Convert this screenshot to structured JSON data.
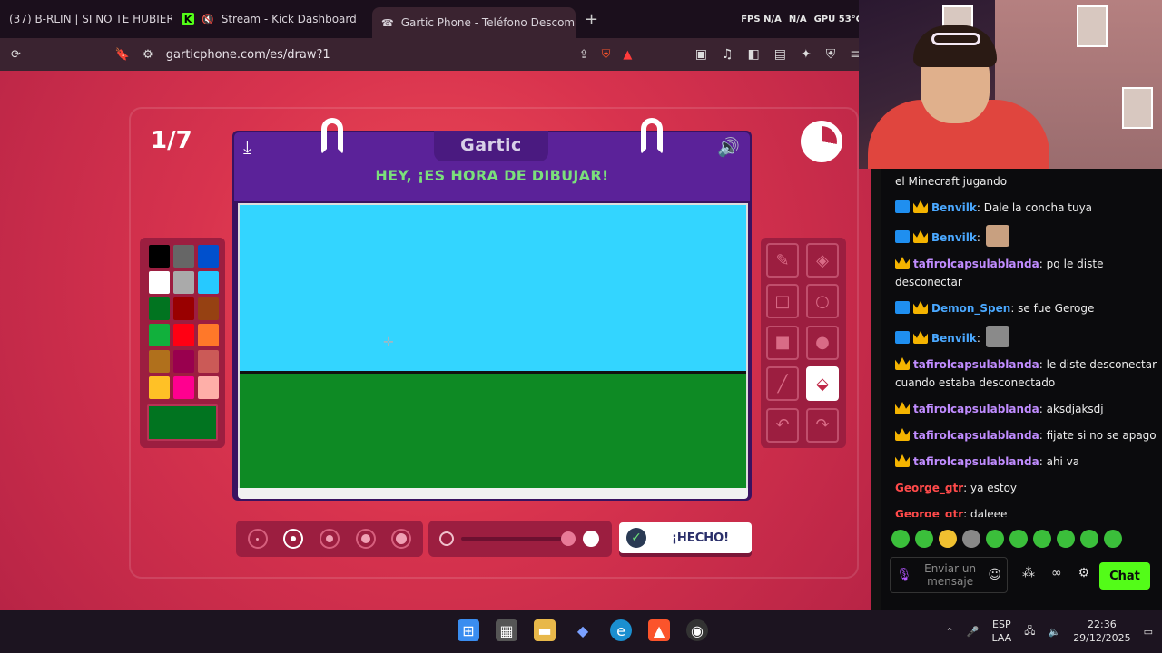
{
  "browser": {
    "tabs": [
      {
        "label": "(37) B-RLIN | SI NO TE HUBIERAS"
      },
      {
        "label": "Stream - Kick Dashboard"
      },
      {
        "label": "Gartic Phone - Teléfono Descom"
      }
    ],
    "new_tab": "+",
    "sysinfo": [
      "FPS N/A",
      "N/A",
      "GPU 53°C"
    ],
    "url": "garticphone.com/es/draw?1"
  },
  "game": {
    "round": "1/7",
    "logo": "Gartic",
    "prompt": "HEY, ¡ES HORA DE DIBUJAR!",
    "done_label": "¡HECHO!",
    "timer_fraction_elapsed": 0.28,
    "palette": [
      "#000000",
      "#666666",
      "#0050cd",
      "#ffffff",
      "#aaaaaa",
      "#26c9ff",
      "#017420",
      "#990000",
      "#964112",
      "#11b03c",
      "#ff0013",
      "#ff7829",
      "#b0701c",
      "#99004e",
      "#cb5a57",
      "#ffc126",
      "#ff008f",
      "#feafa8"
    ],
    "current_color": "#017420",
    "sky_color": "#33d5ff",
    "ground_color": "#0e8a24",
    "tools": [
      "pencil-icon",
      "eraser-icon",
      "rectangle-icon",
      "ellipse-icon",
      "filled-rectangle-icon",
      "filled-ellipse-icon",
      "line-icon",
      "fill-bucket-icon",
      "undo-icon",
      "redo-icon"
    ],
    "selected_tool": "fill-bucket-icon",
    "brush_size_selected_index": 1
  },
  "chat": {
    "messages": [
      {
        "user": "",
        "color": "#ececec",
        "text": "el Minecraft jugando",
        "badges": []
      },
      {
        "user": "Benvilk",
        "color": "#4aa8ff",
        "text": ": Dale la concha tuya",
        "badges": [
          "mod",
          "crown"
        ]
      },
      {
        "user": "Benvilk",
        "color": "#4aa8ff",
        "text": ":",
        "badges": [
          "mod",
          "crown"
        ],
        "emote": true
      },
      {
        "user": "tafirolcapsulablanda",
        "color": "#c08cff",
        "text": ": pq le diste desconectar",
        "badges": [
          "crown"
        ]
      },
      {
        "user": "Demon_Spen",
        "color": "#4aa8ff",
        "text": ": se fue Geroge",
        "badges": [
          "mod",
          "crown"
        ]
      },
      {
        "user": "Benvilk",
        "color": "#4aa8ff",
        "text": ":",
        "badges": [
          "mod",
          "crown"
        ],
        "emote": true
      },
      {
        "user": "tafirolcapsulablanda",
        "color": "#c08cff",
        "text": ": le diste desconectar cuando estaba desconectado",
        "badges": [
          "crown"
        ]
      },
      {
        "user": "tafirolcapsulablanda",
        "color": "#c08cff",
        "text": ": aksdjaksdj",
        "badges": [
          "crown"
        ]
      },
      {
        "user": "tafirolcapsulablanda",
        "color": "#c08cff",
        "text": ": fijate si no se apago",
        "badges": [
          "crown"
        ]
      },
      {
        "user": "tafirolcapsulablanda",
        "color": "#c08cff",
        "text": ": ahi va",
        "badges": [
          "crown"
        ]
      },
      {
        "user": "George_gtr",
        "color": "#ff4a4a",
        "text": ": ya estoy",
        "badges": []
      },
      {
        "user": "George_gtr",
        "color": "#ff4a4a",
        "text": ": daleee",
        "badges": []
      }
    ],
    "input_placeholder": "Enviar un mensaje",
    "send_label": "Chat"
  },
  "taskbar": {
    "lang": "ESP",
    "lang2": "LAA",
    "time": "22:36",
    "date": "29/12/2025"
  }
}
